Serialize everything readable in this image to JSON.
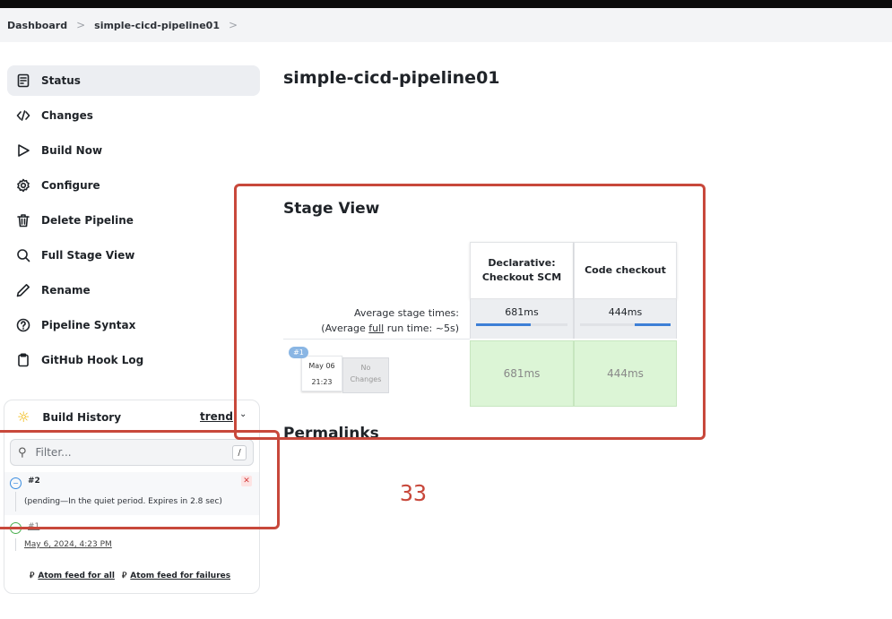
{
  "breadcrumbs": {
    "root": "Dashboard",
    "job": "simple-cicd-pipeline01"
  },
  "sidebar": {
    "items": [
      {
        "label": "Status",
        "icon": "status-icon",
        "active": true
      },
      {
        "label": "Changes",
        "icon": "code-icon"
      },
      {
        "label": "Build Now",
        "icon": "play-icon"
      },
      {
        "label": "Configure",
        "icon": "gear-icon"
      },
      {
        "label": "Delete Pipeline",
        "icon": "trash-icon"
      },
      {
        "label": "Full Stage View",
        "icon": "search-icon"
      },
      {
        "label": "Rename",
        "icon": "pencil-icon"
      },
      {
        "label": "Pipeline Syntax",
        "icon": "help-icon"
      },
      {
        "label": "GitHub Hook Log",
        "icon": "clipboard-icon"
      }
    ]
  },
  "build_history": {
    "title": "Build History",
    "trend_label": "trend",
    "filter_placeholder": "Filter...",
    "filter_shortcut": "/",
    "builds": [
      {
        "number": "#2",
        "status_text": "(pending—In the quiet period. Expires in 2.8 sec)"
      },
      {
        "number": "#1",
        "date": "May 6, 2024, 4:23 PM"
      }
    ],
    "feeds": {
      "all": "Atom feed for all",
      "failures": "Atom feed for failures"
    }
  },
  "main": {
    "title": "simple-cicd-pipeline01",
    "stage_view_title": "Stage View",
    "permalinks_title": "Permalinks",
    "avg_stage_label": "Average stage times:",
    "avg_full_prefix": "(Average ",
    "avg_full_word": "full",
    "avg_full_suffix": " run time: ~5s)",
    "stages": [
      {
        "name_line1": "Declarative:",
        "name_line2": "Checkout SCM",
        "avg": "681ms",
        "avg_fraction": 0.6,
        "run_time": "681ms"
      },
      {
        "name_line1": "Code checkout",
        "name_line2": "",
        "avg": "444ms",
        "avg_fraction": 0.4,
        "run_time": "444ms"
      }
    ],
    "run": {
      "badge": "#1",
      "date": "May 06",
      "time": "21:23",
      "changes_line1": "No",
      "changes_line2": "Changes"
    }
  },
  "annotation": {
    "number": "33",
    "color": "#c8483b"
  }
}
